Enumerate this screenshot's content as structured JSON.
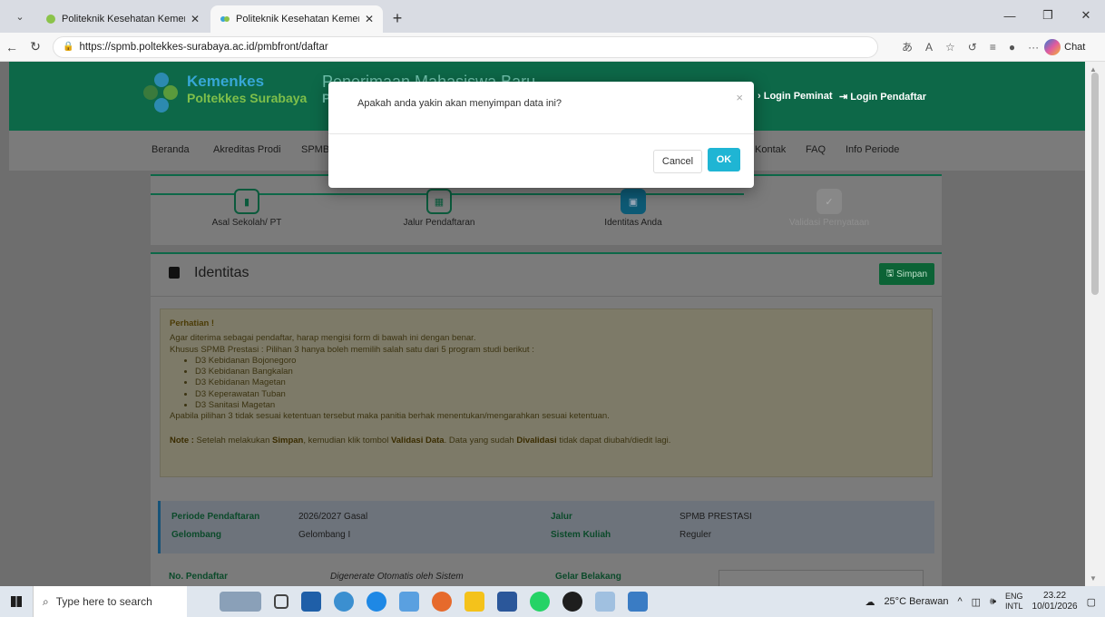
{
  "browser": {
    "tabs": [
      {
        "title": "Politeknik Kesehatan Kemenkes Su",
        "active": false
      },
      {
        "title": "Politeknik Kesehatan Kemenkes Su",
        "active": true
      }
    ],
    "url": "https://spmb.poltekkes-surabaya.ac.id/pmbfront/daftar",
    "chat_label": "Chat"
  },
  "header": {
    "logo_line1": "Kemenkes",
    "logo_line2": "Poltekkes Surabaya",
    "title": "Penerimaan Mahasiswa Baru",
    "subtitle": "P",
    "login_peminat": "Login Peminat",
    "login_pendaftar": "Login Pendaftar"
  },
  "menu": {
    "items": [
      "Beranda",
      "Akreditas Prodi",
      "SPMB",
      "Kontak",
      "FAQ",
      "Info Periode"
    ]
  },
  "steps": [
    {
      "label": "Asal Sekolah/ PT",
      "icon": "document-icon"
    },
    {
      "label": "Jalur Pendaftaran",
      "icon": "calendar-icon"
    },
    {
      "label": "Identitas Anda",
      "icon": "id-card-icon"
    },
    {
      "label": "Validasi Pernyataan",
      "icon": "check-icon"
    }
  ],
  "identity": {
    "title": "Identitas",
    "save_label": "Simpan"
  },
  "notice": {
    "heading": "Perhatian !",
    "line1": "Agar diterima sebagai pendaftar, harap mengisi form di bawah ini dengan benar.",
    "line2": "Khusus SPMB Prestasi : Pilihan 3 hanya boleh memilih salah satu dari 5 program studi berikut :",
    "programs": [
      "D3 Kebidanan Bojonegoro",
      "D3 Kebidanan Bangkalan",
      "D3 Kebidanan Magetan",
      "D3 Keperawatan Tuban",
      "D3 Sanitasi Magetan"
    ],
    "line3": "Apabila pilihan 3 tidak sesuai ketentuan tersebut maka panitia berhak menentukan/mengarahkan sesuai ketentuan.",
    "note_label": "Note :",
    "note_part1": " Setelah melakukan ",
    "note_simpan": "Simpan",
    "note_part2": ", kemudian klik tombol ",
    "note_validasi": "Validasi Data",
    "note_part3": ". Data yang sudah ",
    "note_divalidasi": "Divalidasi",
    "note_part4": " tidak dapat diubah/diedit lagi."
  },
  "info": {
    "periode_label": "Periode Pendaftaran",
    "periode_value": "2026/2027 Gasal",
    "gelombang_label": "Gelombang",
    "gelombang_value": "Gelombang I",
    "jalur_label": "Jalur",
    "jalur_value": "SPMB PRESTASI",
    "sistem_label": "Sistem Kuliah",
    "sistem_value": "Reguler"
  },
  "form": {
    "no_pendaftar_label": "No. Pendaftar",
    "no_pendaftar_value": "Digenerate Otomatis oleh Sistem",
    "gelar_label": "Gelar Belakang"
  },
  "modal": {
    "message": "Apakah anda yakin akan menyimpan data ini?",
    "cancel_label": "Cancel",
    "ok_label": "OK"
  },
  "taskbar": {
    "search_placeholder": "Type here to search",
    "weather": "25°C Berawan",
    "lang1": "ENG",
    "lang2": "INTL",
    "time": "23.22",
    "date": "10/01/2026"
  }
}
